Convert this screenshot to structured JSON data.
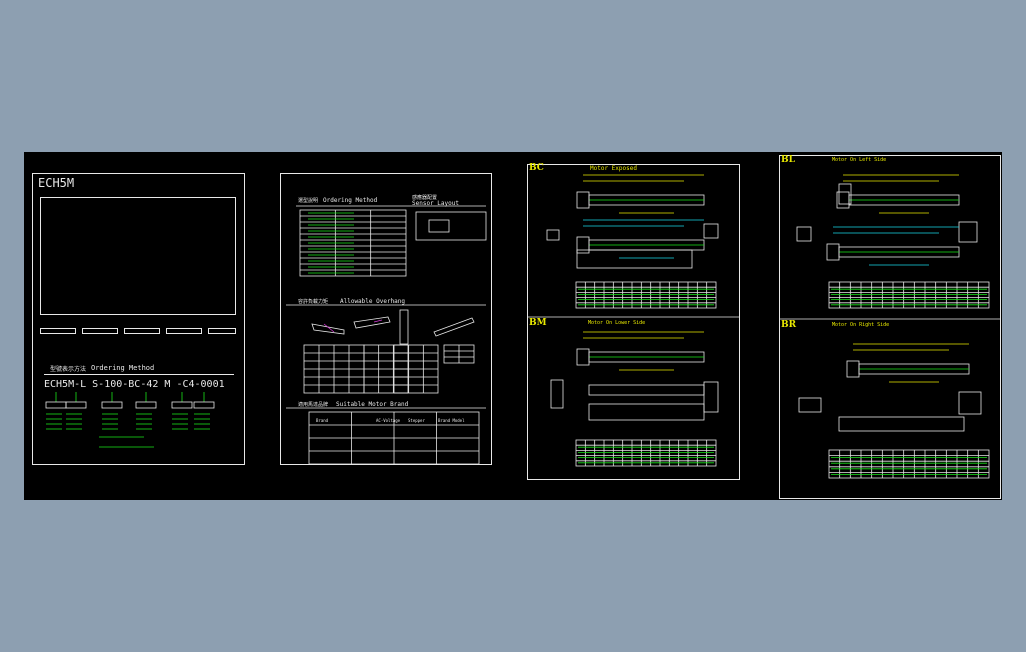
{
  "colors": {
    "background": "#8d9fb1",
    "canvas": "#000000",
    "line_white": "#e8e8e8",
    "line_green": "#18e418",
    "line_yellow": "#e8e800",
    "line_cyan": "#18d8e8",
    "line_magenta": "#d838d8"
  },
  "sheet1": {
    "model": "ECH5M",
    "ordering_heading": "Ordering Method",
    "ordering_heading_cn": "型號表示方法",
    "order_code": "ECH5M-L S-100-BC-42 M -C4-0001"
  },
  "sheet2": {
    "ordering_method": "Ordering Method",
    "ordering_method_cn": "選型說明",
    "sensor_layout": "Sensor Layout",
    "sensor_layout_cn": "感應器配置",
    "allowable_overhang": "Allowable Overhang",
    "allowable_overhang_cn": "容許負載力矩",
    "suitable_motor_brand": "Suitable Motor Brand",
    "suitable_motor_brand_cn": "適用馬達品牌",
    "brand_col": "Brand",
    "voltage_col": "AC-Voltage",
    "stepper_col": "Stepper",
    "brand_model_col": "Brand Model"
  },
  "sheet3": {
    "top_code": "BC",
    "top_title": "Motor Exposed",
    "mid_code": "BM",
    "mid_title": "Motor On Lower Side"
  },
  "sheet4": {
    "top_code": "BL",
    "top_title": "Motor On Left Side",
    "mid_code": "BR",
    "mid_title": "Motor On Right Side"
  }
}
